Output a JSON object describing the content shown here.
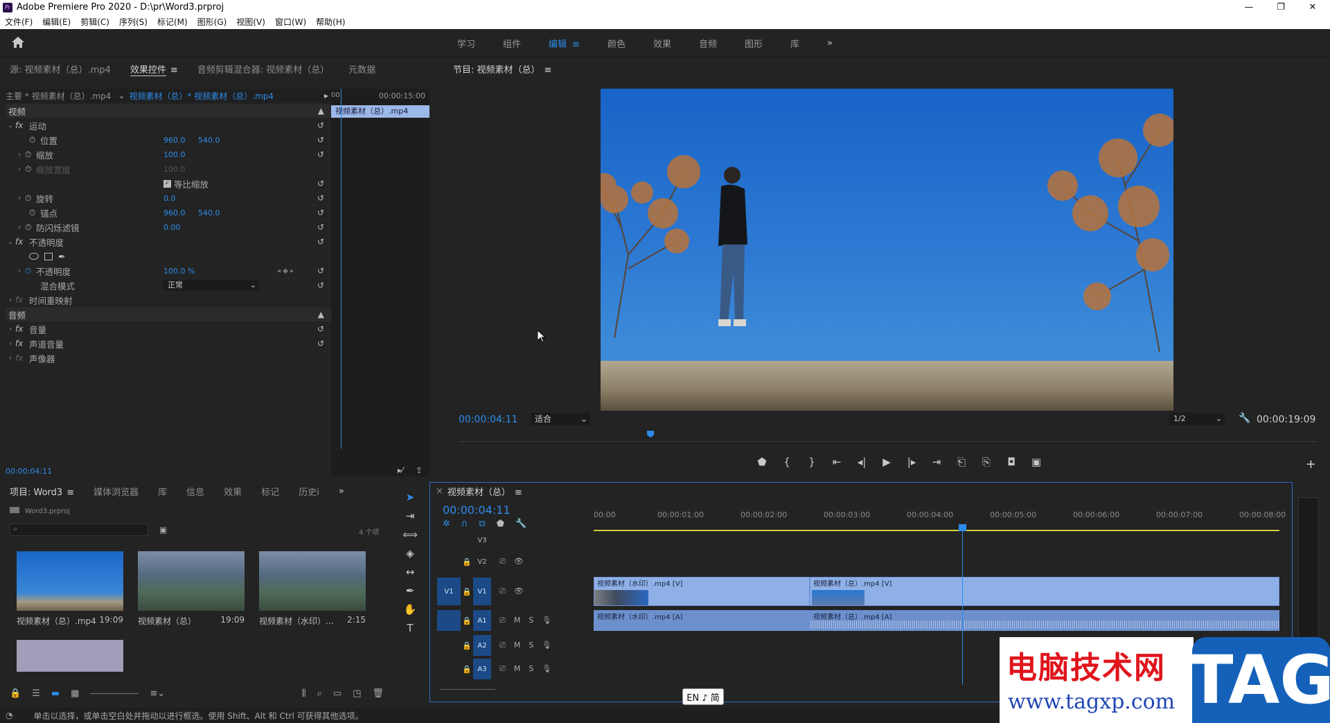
{
  "window": {
    "title": "Adobe Premiere Pro 2020 - D:\\pr\\Word3.prproj",
    "icon_text": "Pr",
    "controls": [
      "—",
      "❐",
      "✕"
    ]
  },
  "menu": [
    "文件(F)",
    "编辑(E)",
    "剪辑(C)",
    "序列(S)",
    "标记(M)",
    "图形(G)",
    "视图(V)",
    "窗口(W)",
    "帮助(H)"
  ],
  "workspaces": {
    "tabs": [
      "学习",
      "组件",
      "编辑",
      "颜色",
      "效果",
      "音频",
      "图形",
      "库"
    ],
    "active": "编辑",
    "more": "»"
  },
  "effects_panel": {
    "tabs": [
      "源: 视频素材（总）.mp4",
      "效果控件",
      "音频剪辑混合器: 视频素材（总）",
      "元数据"
    ],
    "active_tab": "效果控件",
    "master": "主要 * 视频素材（总）.mp4",
    "clip": "视频素材（总）* 视频素材（总）.mp4",
    "tl_start": "00",
    "tl_end": "00:00:15:00",
    "tl_clip": "视频素材（总）.mp4",
    "current_time": "00:00:04:11",
    "rows": {
      "video_section": "视频",
      "motion": "运动",
      "position": "位置",
      "position_x": "960.0",
      "position_y": "540.0",
      "scale": "缩放",
      "scale_v": "100.0",
      "scale_width": "缩放宽度",
      "scale_width_v": "100.0",
      "uniform": "等比缩放",
      "rotation": "旋转",
      "rotation_v": "0.0",
      "anchor": "锚点",
      "anchor_x": "960.0",
      "anchor_y": "540.0",
      "flicker": "防闪烁滤镜",
      "flicker_v": "0.00",
      "opacity_group": "不透明度",
      "opacity": "不透明度",
      "opacity_v": "100.0 %",
      "blend": "混合模式",
      "blend_v": "正常",
      "time_remap": "时间重映射",
      "audio_section": "音频",
      "volume": "音量",
      "channel_volume": "声道音量",
      "panner": "声像器"
    }
  },
  "program_monitor": {
    "title": "节目: 视频素材（总）",
    "current_time": "00:00:04:11",
    "fit": "适合",
    "resolution": "1/2",
    "duration": "00:00:19:09"
  },
  "project_panel": {
    "tabs": [
      "项目: Word3",
      "媒体浏览器",
      "库",
      "信息",
      "效果",
      "标记",
      "历史i"
    ],
    "active_tab": "项目: Word3",
    "path": "Word3.prproj",
    "count": "4 个项",
    "items": [
      {
        "name": "视频素材（总）.mp4",
        "duration": "19:09"
      },
      {
        "name": "视频素材（总）",
        "duration": "19:09"
      },
      {
        "name": "视频素材（水印）...",
        "duration": "2:15"
      }
    ]
  },
  "timeline": {
    "title": "视频素材（总）",
    "current_time": "00:00:04:11",
    "ruler": [
      "00:00",
      "00:00:01:00",
      "00:00:02:00",
      "00:00:03:00",
      "00:00:04:00",
      "00:00:05:00",
      "00:00:06:00",
      "00:00:07:00",
      "00:00:08:00"
    ],
    "tracks": {
      "v3": "V3",
      "v2": "V2",
      "v1": "V1",
      "a1": "A1",
      "a2": "A2",
      "a3": "A3",
      "src_v": "V1",
      "src_a": "A1",
      "m": "M",
      "s": "S"
    },
    "clips": {
      "v1a": "视频素材（水印）.mp4 [V]",
      "v1b": "视频素材（总）.mp4 [V]",
      "a1a": "视频素材（水印）.mp4 [A]",
      "a1b": "视频素材（总）.mp4 [A]"
    }
  },
  "status": {
    "text": "单击以选择，或单击空白处并拖动以进行框选。使用 Shift、Alt 和 Ctrl 可获得其他选项。",
    "ime": "EN ♪ 简"
  },
  "watermark": {
    "cn": "电脑技术网",
    "url": "www.tagxp.com",
    "tag": "TAG"
  },
  "colors": {
    "accent": "#2d8ceb",
    "clip_video": "#8fb0e6",
    "clip_audio": "#6d90cc",
    "work_area": "#d6cf3c"
  }
}
